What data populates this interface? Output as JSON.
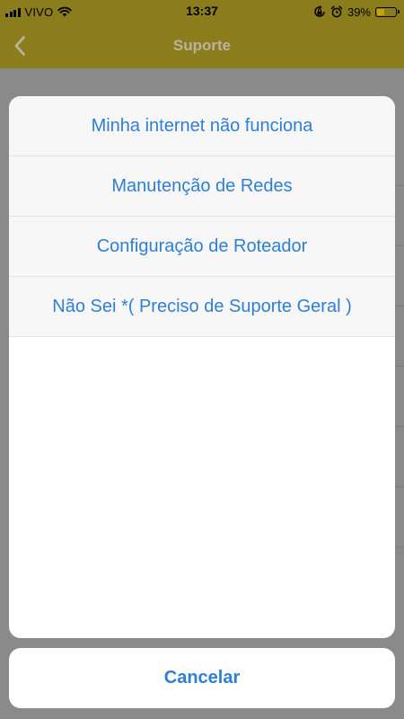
{
  "status_bar": {
    "carrier": "VIVO",
    "time": "13:37",
    "battery_percent": "39%",
    "battery_level": 0.39,
    "icons": [
      "signal-icon",
      "wifi-icon",
      "lock-rotation-icon",
      "alarm-icon",
      "battery-icon"
    ]
  },
  "nav": {
    "title": "Suporte",
    "back_icon": "chevron-left-icon"
  },
  "action_sheet": {
    "options": [
      {
        "label": "Minha internet não funciona"
      },
      {
        "label": "Manutenção de Redes"
      },
      {
        "label": "Configuração de Roteador"
      },
      {
        "label": "Não Sei *( Preciso de Suporte Geral )"
      }
    ],
    "cancel_label": "Cancelar"
  },
  "colors": {
    "accent": "#2f7fd6",
    "nav_bar_dimmed": "#8b7d1c",
    "backdrop": "#8a8a8a",
    "battery": "#c9a300"
  }
}
